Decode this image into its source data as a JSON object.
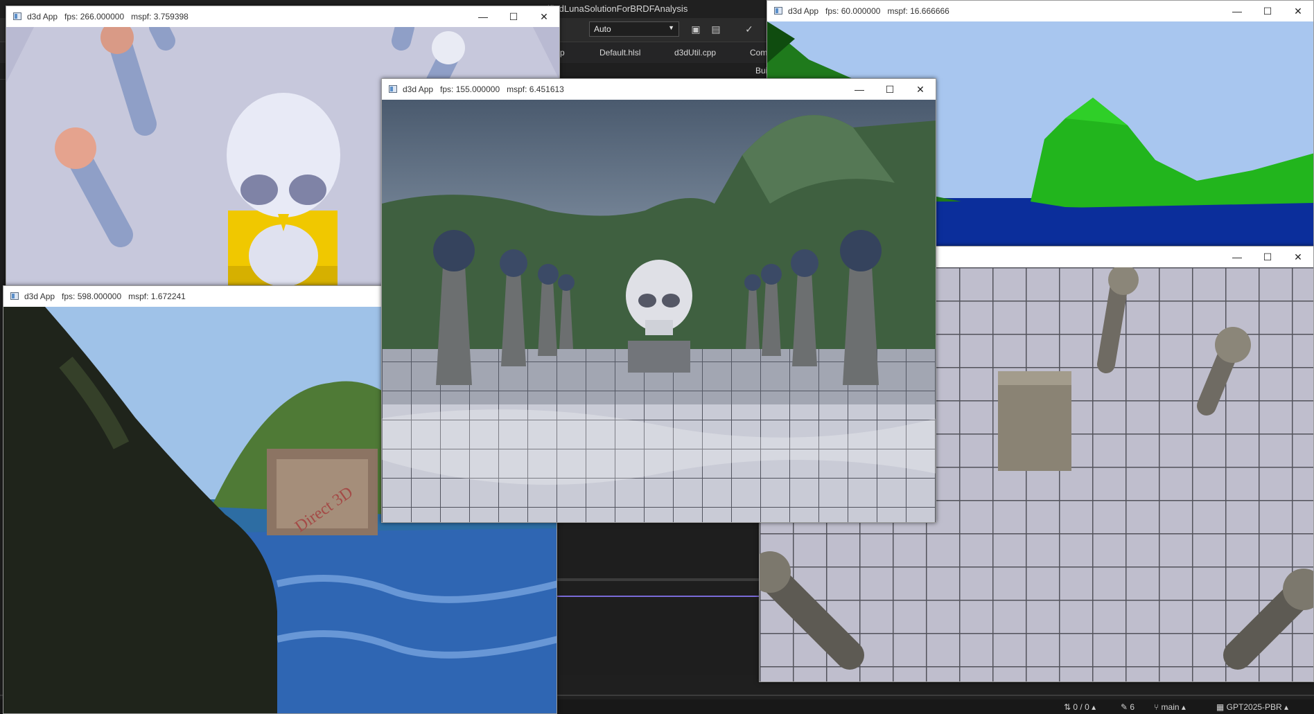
{
  "ide": {
    "title": "ifiedLunaSolutionForBRDFAnalysis",
    "config": "Auto",
    "tabs": [
      "p",
      "Default.hlsl",
      "d3dUtil.cpp",
      "Com"
    ],
    "nav_right": "Bui",
    "status": {
      "lines": "0 / 0",
      "edits": "6",
      "branch": "main",
      "repo": "GPT2025-PBR"
    }
  },
  "windows": {
    "shapes": {
      "app": "d3d App",
      "fps": "fps: 266.000000",
      "mspf": "mspf: 3.759398"
    },
    "terrain": {
      "app": "d3d App",
      "fps": "fps: 60.000000",
      "mspf": "mspf: 16.666666"
    },
    "skull": {
      "app": "d3d App",
      "fps": "fps: 155.000000",
      "mspf": "mspf: 6.451613"
    },
    "blend": {
      "app": "d3d App",
      "fps": "fps: 598.000000",
      "mspf": "mspf: 1.672241"
    },
    "crate_text": "Direct 3D"
  },
  "icons": {
    "minimize": "minimize-icon",
    "maximize": "maximize-icon",
    "close": "close-icon",
    "app": "app-window-icon"
  },
  "controls": {
    "minimize": "—",
    "maximize": "☐",
    "close": "✕"
  },
  "colors": {
    "ide_bg": "#1e1e1e",
    "titlebar": "#ffffff",
    "accent_purple": "#7a6bd8"
  }
}
